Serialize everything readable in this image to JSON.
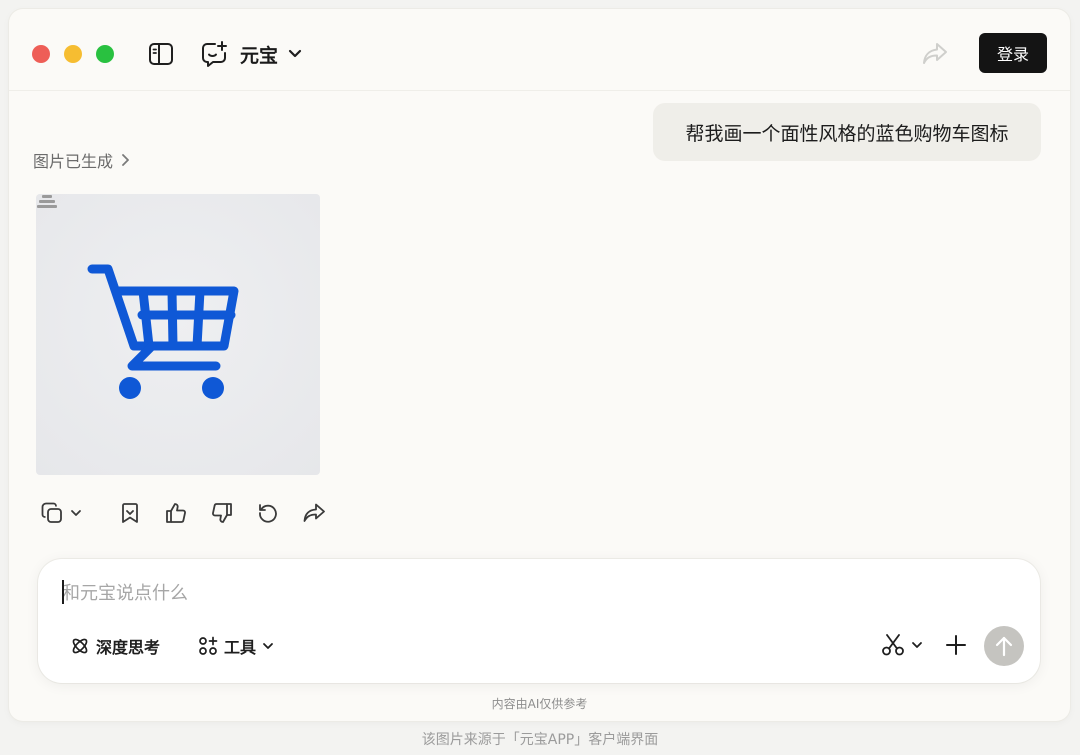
{
  "header": {
    "app_title": "元宝",
    "login_label": "登录"
  },
  "chat": {
    "user_message": "帮我画一个面性风格的蓝色购物车图标",
    "status": "图片已生成"
  },
  "composer": {
    "placeholder": "和元宝说点什么",
    "deep_think_label": "深度思考",
    "tools_label": "工具"
  },
  "disclaimer": "内容由AI仅供参考",
  "footer_note": "该图片来源于「元宝APP」客户端界面",
  "colors": {
    "cart_blue": "#0f58d6",
    "login_bg": "#141414",
    "send_disabled": "#c5c4c0",
    "traffic_red": "#ee5e57",
    "traffic_yellow": "#f6bd31",
    "traffic_green": "#29c140"
  },
  "icons": {
    "sidebar": "sidebar-toggle-icon",
    "new_chat": "new-chat-icon",
    "share": "share-icon",
    "copy": "copy-icon",
    "bookmark": "bookmark-icon",
    "like": "thumbs-up-icon",
    "dislike": "thumbs-down-icon",
    "regenerate": "refresh-icon",
    "forward": "share-icon",
    "deep_think": "atom-icon",
    "tools": "apps-icon",
    "scissors": "scissors-icon",
    "plus": "plus-icon",
    "send": "arrow-up-icon"
  }
}
